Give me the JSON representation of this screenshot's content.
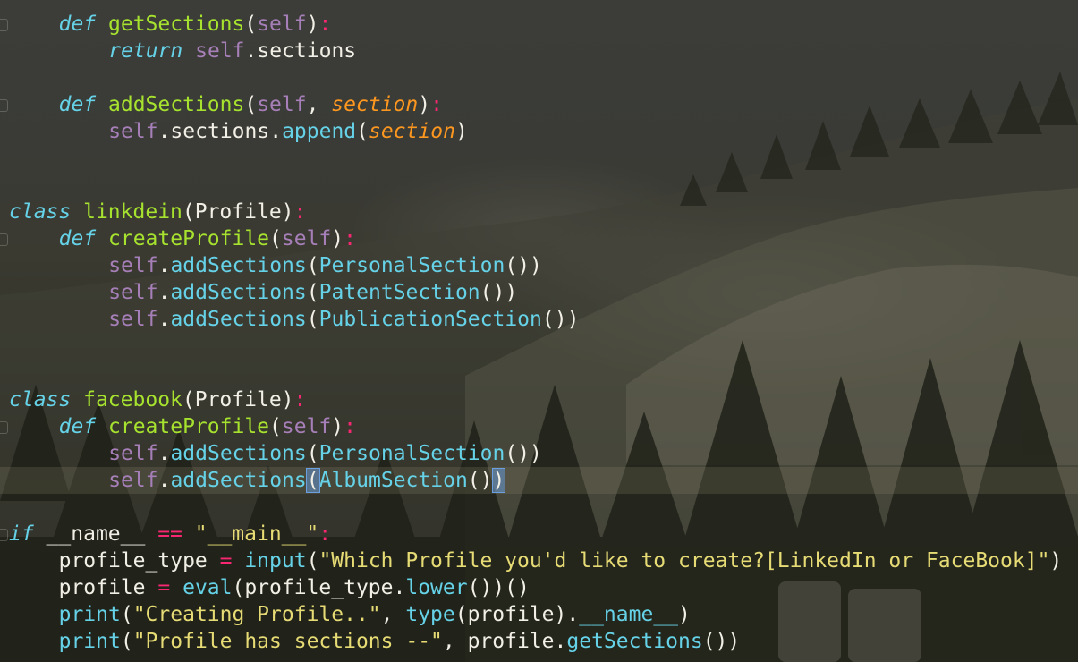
{
  "editor": {
    "lines": [
      {
        "indent": 4,
        "tokens": [
          [
            "kw-italic",
            "def"
          ],
          [
            "plain",
            " "
          ],
          [
            "fn",
            "getSections"
          ],
          [
            "plain",
            "("
          ],
          [
            "self",
            "self"
          ],
          [
            "plain",
            ")"
          ],
          [
            "punct",
            ":"
          ]
        ]
      },
      {
        "indent": 8,
        "tokens": [
          [
            "kw-ret",
            "return"
          ],
          [
            "plain",
            " "
          ],
          [
            "self",
            "self"
          ],
          [
            "plain",
            ".sections"
          ]
        ]
      },
      {
        "indent": 0,
        "tokens": []
      },
      {
        "indent": 4,
        "tokens": [
          [
            "kw-italic",
            "def"
          ],
          [
            "plain",
            " "
          ],
          [
            "fn",
            "addSections"
          ],
          [
            "plain",
            "("
          ],
          [
            "self",
            "self"
          ],
          [
            "plain",
            ", "
          ],
          [
            "param",
            "section"
          ],
          [
            "plain",
            ")"
          ],
          [
            "punct",
            ":"
          ]
        ]
      },
      {
        "indent": 8,
        "tokens": [
          [
            "self",
            "self"
          ],
          [
            "plain",
            ".sections."
          ],
          [
            "call",
            "append"
          ],
          [
            "plain",
            "("
          ],
          [
            "param",
            "section"
          ],
          [
            "plain",
            ")"
          ]
        ]
      },
      {
        "indent": 0,
        "tokens": []
      },
      {
        "indent": 0,
        "tokens": []
      },
      {
        "indent": 0,
        "tokens": [
          [
            "kw-italic",
            "class"
          ],
          [
            "plain",
            " "
          ],
          [
            "cls-name",
            "linkdein"
          ],
          [
            "plain",
            "(Profile)"
          ],
          [
            "punct",
            ":"
          ]
        ]
      },
      {
        "indent": 4,
        "tokens": [
          [
            "kw-italic",
            "def"
          ],
          [
            "plain",
            " "
          ],
          [
            "fn",
            "createProfile"
          ],
          [
            "plain",
            "("
          ],
          [
            "self",
            "self"
          ],
          [
            "plain",
            ")"
          ],
          [
            "punct",
            ":"
          ]
        ]
      },
      {
        "indent": 8,
        "tokens": [
          [
            "self",
            "self"
          ],
          [
            "plain",
            "."
          ],
          [
            "call",
            "addSections"
          ],
          [
            "plain",
            "("
          ],
          [
            "call",
            "PersonalSection"
          ],
          [
            "plain",
            "())"
          ]
        ]
      },
      {
        "indent": 8,
        "tokens": [
          [
            "self",
            "self"
          ],
          [
            "plain",
            "."
          ],
          [
            "call",
            "addSections"
          ],
          [
            "plain",
            "("
          ],
          [
            "call",
            "PatentSection"
          ],
          [
            "plain",
            "())"
          ]
        ]
      },
      {
        "indent": 8,
        "tokens": [
          [
            "self",
            "self"
          ],
          [
            "plain",
            "."
          ],
          [
            "call",
            "addSections"
          ],
          [
            "plain",
            "("
          ],
          [
            "call",
            "PublicationSection"
          ],
          [
            "plain",
            "())"
          ]
        ]
      },
      {
        "indent": 0,
        "tokens": []
      },
      {
        "indent": 0,
        "tokens": []
      },
      {
        "indent": 0,
        "tokens": [
          [
            "kw-italic",
            "class"
          ],
          [
            "plain",
            " "
          ],
          [
            "cls-name",
            "facebook"
          ],
          [
            "plain",
            "(Profile)"
          ],
          [
            "punct",
            ":"
          ]
        ]
      },
      {
        "indent": 4,
        "tokens": [
          [
            "kw-italic",
            "def"
          ],
          [
            "plain",
            " "
          ],
          [
            "fn",
            "createProfile"
          ],
          [
            "plain",
            "("
          ],
          [
            "self",
            "self"
          ],
          [
            "plain",
            ")"
          ],
          [
            "punct",
            ":"
          ]
        ]
      },
      {
        "indent": 8,
        "tokens": [
          [
            "self",
            "self"
          ],
          [
            "plain",
            "."
          ],
          [
            "call",
            "addSections"
          ],
          [
            "plain",
            "("
          ],
          [
            "call",
            "PersonalSection"
          ],
          [
            "plain",
            "())"
          ]
        ]
      },
      {
        "indent": 8,
        "current": true,
        "tokens": [
          [
            "self",
            "self"
          ],
          [
            "plain",
            "."
          ],
          [
            "call",
            "addSections"
          ],
          [
            "bracket-match",
            "("
          ],
          [
            "call",
            "AlbumSection"
          ],
          [
            "plain",
            "()"
          ],
          [
            "bracket-match",
            ")"
          ]
        ]
      },
      {
        "indent": 0,
        "tokens": []
      },
      {
        "indent": 0,
        "tokens": [
          [
            "kw-italic",
            "if"
          ],
          [
            "plain",
            " __name__ "
          ],
          [
            "op",
            "=="
          ],
          [
            "plain",
            " "
          ],
          [
            "str",
            "\"__main__\""
          ],
          [
            "punct",
            ":"
          ]
        ]
      },
      {
        "indent": 4,
        "tokens": [
          [
            "plain",
            "profile_type "
          ],
          [
            "op",
            "="
          ],
          [
            "plain",
            " "
          ],
          [
            "builtin",
            "input"
          ],
          [
            "plain",
            "("
          ],
          [
            "str",
            "\"Which Profile you'd like to create?[LinkedIn or FaceBook]\""
          ],
          [
            "plain",
            ")"
          ]
        ]
      },
      {
        "indent": 4,
        "tokens": [
          [
            "plain",
            "profile "
          ],
          [
            "op",
            "="
          ],
          [
            "plain",
            " "
          ],
          [
            "builtin",
            "eval"
          ],
          [
            "plain",
            "(profile_type."
          ],
          [
            "call",
            "lower"
          ],
          [
            "plain",
            "())()"
          ]
        ]
      },
      {
        "indent": 4,
        "tokens": [
          [
            "builtin",
            "print"
          ],
          [
            "plain",
            "("
          ],
          [
            "str",
            "\"Creating Profile..\""
          ],
          [
            "plain",
            ", "
          ],
          [
            "builtin",
            "type"
          ],
          [
            "plain",
            "(profile)."
          ],
          [
            "call",
            "__name__"
          ],
          [
            "plain",
            ")"
          ]
        ]
      },
      {
        "indent": 4,
        "tokens": [
          [
            "builtin",
            "print"
          ],
          [
            "plain",
            "("
          ],
          [
            "str",
            "\"Profile has sections --\""
          ],
          [
            "plain",
            ", profile."
          ],
          [
            "call",
            "getSections"
          ],
          [
            "plain",
            "())"
          ]
        ]
      }
    ],
    "fold_markers": [
      0,
      3,
      8,
      15,
      19
    ]
  }
}
